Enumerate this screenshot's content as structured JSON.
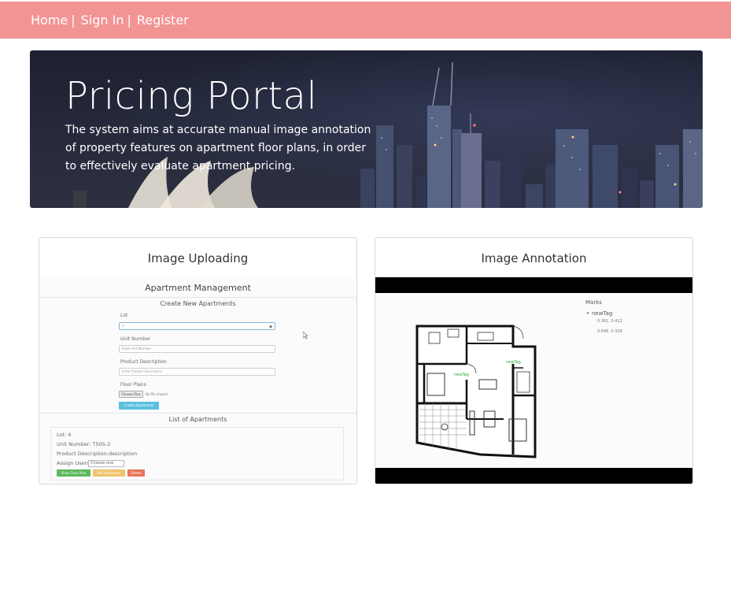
{
  "nav": {
    "home": "Home",
    "sign_in": "Sign In",
    "register": "Register",
    "separator": "|"
  },
  "hero": {
    "title": "Pricing Portal",
    "description": "The system aims at accurate manual image annotation of property features on apartment floor plans, in order to effectively evaluate apartment pricing."
  },
  "cards": {
    "upload": {
      "title": "Image Uploading",
      "screenshot": {
        "heading": "Apartment Management",
        "create_heading": "Create New Apartments",
        "lot_label": "Lot",
        "lot_value": "1",
        "unit_label": "Unit Number",
        "unit_placeholder": "Enter Unit Number",
        "desc_label": "Product Description",
        "desc_placeholder": "Enter Product Description",
        "floor_label": "Floor Plans",
        "choose_files": "Choose Files",
        "no_file": "No file chosen",
        "create_button": "Create Apartments",
        "list_heading": "List of Apartments",
        "item_lot": "Lot: 4",
        "item_unit": "Unit Number: T505-2",
        "item_desc": "Product Description:description",
        "assign_label": "Assign Users:",
        "assign_select": "Choose one",
        "show_plan": "Show Floor Plan",
        "edit": "Edit Apartment",
        "delete": "Delete"
      }
    },
    "annotation": {
      "title": "Image Annotation",
      "screenshot": {
        "marks_title": "Marks",
        "mark_name": "newTag",
        "coord_1": "0.361, 0.412",
        "coord_2": "0.646, 0.330",
        "plan_tag_1": "newTag",
        "plan_tag_2": "newTag"
      }
    }
  },
  "colors": {
    "navbar": "#f29494",
    "accent_info": "#5bc0de",
    "success": "#5cb85c",
    "warning": "#f0c36d",
    "danger": "#e8735a"
  }
}
